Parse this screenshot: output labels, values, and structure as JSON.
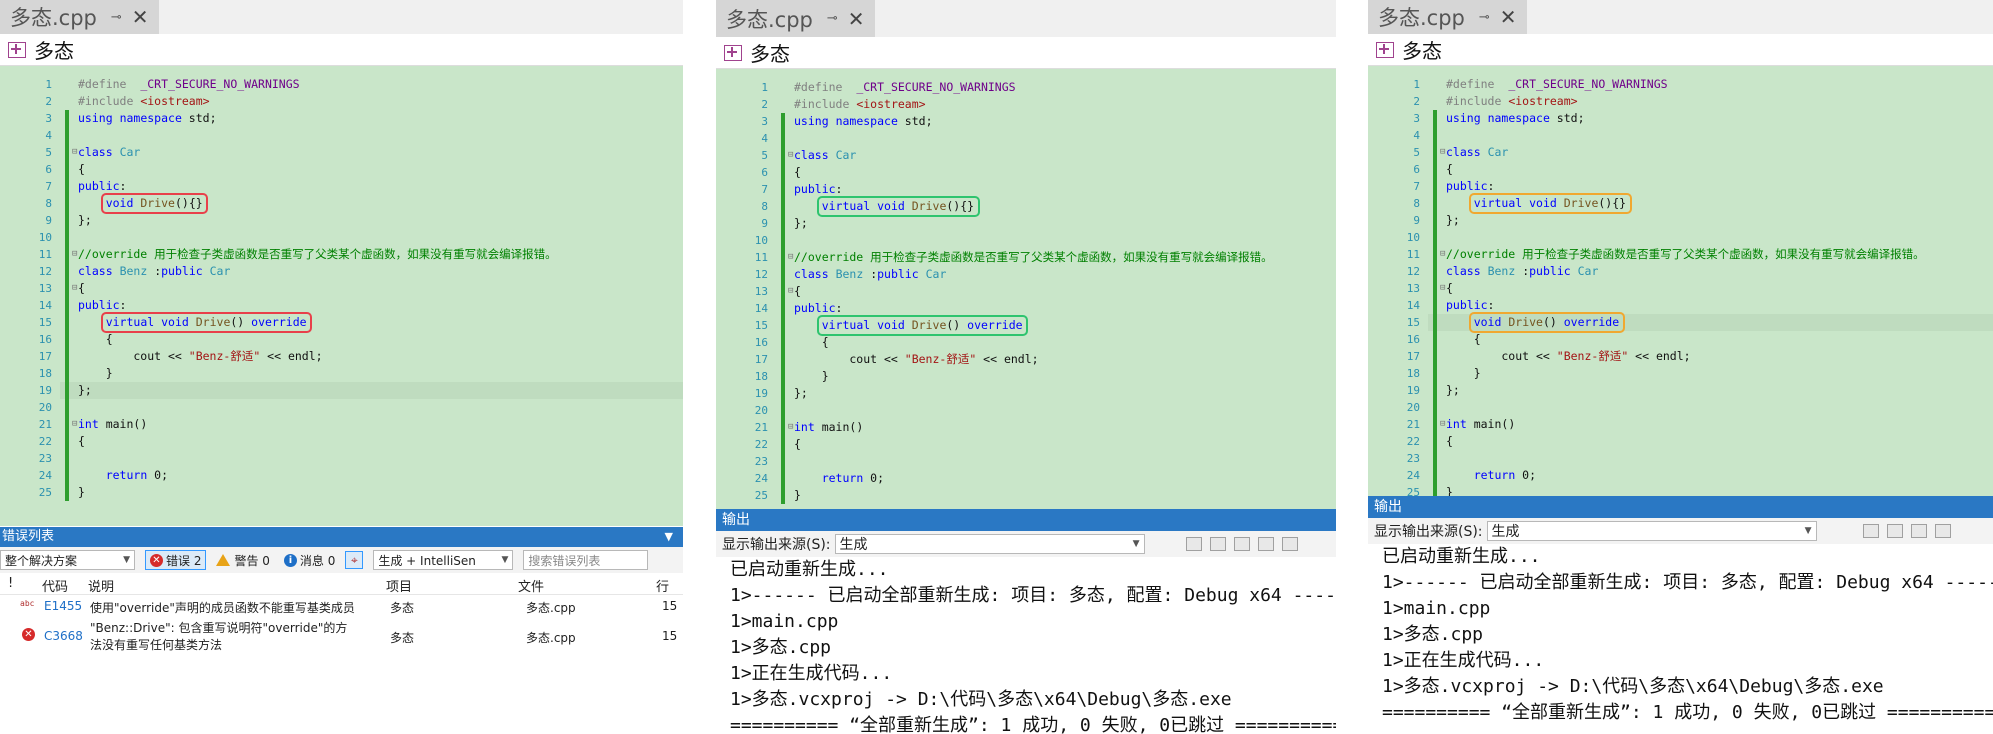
{
  "tabs": {
    "title": "多态.cpp",
    "pin": "⊸",
    "close": "✕"
  },
  "navbar": {
    "scope": "多态",
    "icon": "class-icon"
  },
  "code": {
    "lines": [
      "#define  _CRT_SECURE_NO_WARNINGS",
      "#include <iostream>",
      "using namespace std;",
      "",
      "class Car",
      "{",
      "public:",
      "    void Drive(){}",
      "};",
      "",
      "//override 用于检查子类虚函数是否重写了父类某个虚函数，如果没有重写就会编译报错。",
      "class Benz :public Car",
      "{",
      "public:",
      "    virtual void Drive() override",
      "    {",
      "        cout << \"Benz-舒适\" << endl;",
      "    }",
      "};",
      "",
      "int main()",
      "{",
      "",
      "    return 0;",
      "}"
    ],
    "variants": [
      {
        "line8": "    void Drive(){}",
        "line15": "    virtual void Drive() override",
        "box_color": "#e8404a"
      },
      {
        "line8": "    virtual void Drive(){}",
        "line15": "    virtual void Drive() override",
        "box_color": "#2ec46e"
      },
      {
        "line8": "    virtual void Drive(){}",
        "line15": "    void Drive() override",
        "box_color": "#f0a830"
      }
    ]
  },
  "error_list": {
    "title": "错误列表",
    "scope_select": "整个解决方案",
    "errors_btn": "错误 2",
    "warnings_btn": "警告 0",
    "messages_btn": "消息 0",
    "build_select": "生成 + IntelliSen",
    "search_placeholder": "搜索错误列表",
    "headers": {
      "code": "代码",
      "description": "说明",
      "project": "项目",
      "file": "文件",
      "line": "行"
    },
    "rows": [
      {
        "code": "E1455",
        "description": "使用\"override\"声明的成员函数不能重写基类成员",
        "project": "多态",
        "file": "多态.cpp",
        "line": "15"
      },
      {
        "code": "C3668",
        "description": "\"Benz::Drive\": 包含重写说明符\"override\"的方",
        "description2": "法没有重写任何基类方法",
        "project": "多态",
        "file": "多态.cpp",
        "line": "15"
      }
    ]
  },
  "output": {
    "title": "输出",
    "source_label": "显示输出来源(S):",
    "source_value": "生成",
    "lines": [
      "已启动重新生成...",
      "1>------ 已启动全部重新生成: 项目: 多态, 配置: Debug x64 ------",
      "1>main.cpp",
      "1>多态.cpp",
      "1>正在生成代码...",
      "1>多态.vcxproj -> D:\\代码\\多态\\x64\\Debug\\多态.exe",
      "========== “全部重新生成”: 1 成功, 0 失败, 0已跳过 =========="
    ]
  },
  "colors": {
    "editor_bg": "#c9e6c9",
    "keyword": "#0000ff",
    "type": "#2b91af",
    "comment": "#008000",
    "string": "#a31515",
    "preprocessor": "#808080",
    "panel_title_bg": "#2a78c4"
  }
}
